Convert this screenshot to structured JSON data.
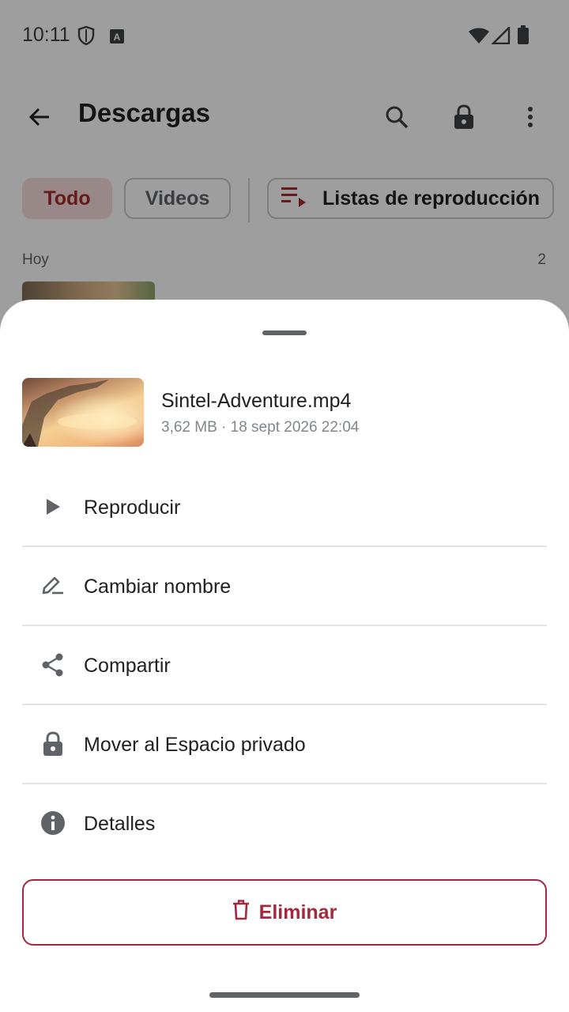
{
  "status_bar": {
    "time": "10:11",
    "icons": [
      "shield-icon",
      "keyboard-a-icon",
      "wifi-icon",
      "signal-icon",
      "battery-icon"
    ]
  },
  "app_bar": {
    "title": "Descargas",
    "icons": [
      "back-arrow-icon",
      "search-icon",
      "lock-icon",
      "more-vert-icon"
    ]
  },
  "filters": {
    "todo": "Todo",
    "videos": "Videos",
    "playlists": "Listas de reproducción"
  },
  "list": {
    "section_label": "Hoy",
    "section_count": "2"
  },
  "sheet": {
    "file_name": "Sintel-Adventure.mp4",
    "file_meta": "3,62 MB · 18 sept 2026 22:04",
    "actions": [
      {
        "label": "Reproducir",
        "icon": "play-icon"
      },
      {
        "label": "Cambiar nombre",
        "icon": "rename-pen-icon"
      },
      {
        "label": "Compartir",
        "icon": "share-icon"
      },
      {
        "label": "Mover al Espacio privado",
        "icon": "lock-icon"
      },
      {
        "label": "Detalles",
        "icon": "info-icon"
      }
    ],
    "delete_label": "Eliminar"
  },
  "colors": {
    "accent": "#a5283d",
    "chip_selected_bg": "#f7dcdc",
    "scrim": "rgba(0,0,0,0.38)"
  }
}
